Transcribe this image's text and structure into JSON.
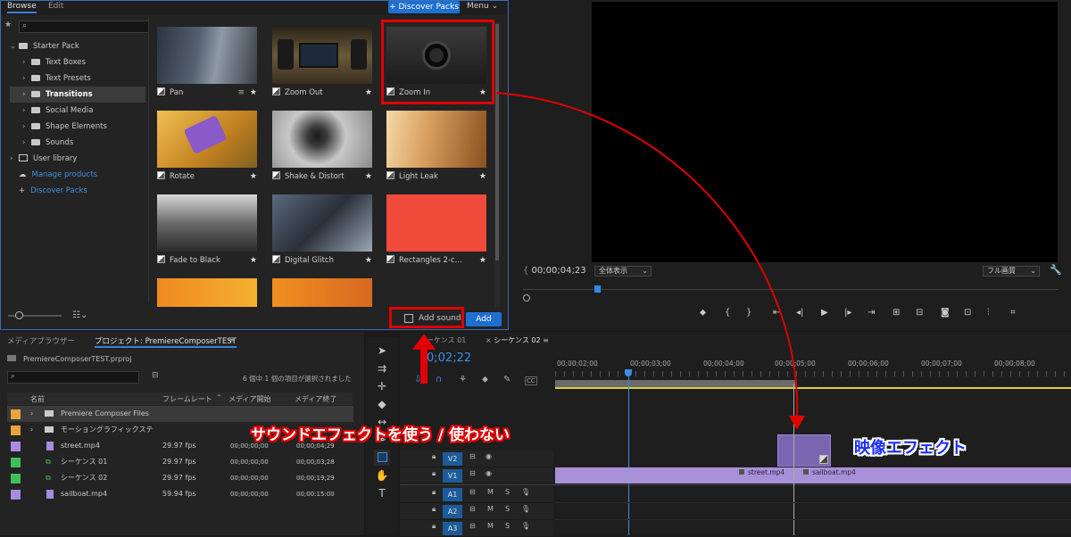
{
  "plugin": {
    "tabs": [
      "Browse",
      "Edit"
    ],
    "discover_button": "+ Discover Packs",
    "menu_label": "Menu",
    "search_placeholder": "",
    "tree": [
      {
        "label": "Starter Pack",
        "caret": "v"
      },
      {
        "label": "Text Boxes",
        "caret": ">"
      },
      {
        "label": "Text Presets",
        "caret": ">"
      },
      {
        "label": "Transitions",
        "caret": ">"
      },
      {
        "label": "Social Media",
        "caret": ">"
      },
      {
        "label": "Shape Elements",
        "caret": ">"
      },
      {
        "label": "Sounds",
        "caret": ">"
      },
      {
        "label": "User library",
        "caret": ">"
      },
      {
        "label": "Manage products"
      },
      {
        "label": "Discover Packs"
      }
    ],
    "tiles": [
      "Pan",
      "Zoom Out",
      "Zoom In",
      "Rotate",
      "Shake & Distort",
      "Light Leak",
      "Fade to Black",
      "Digital Glitch",
      "Rectangles 2-c..."
    ],
    "add_sound_label": "Add sound",
    "add_button": "Add",
    "selected_category": "Transitions",
    "selected_tile": "Zoom In"
  },
  "monitor": {
    "timecode": "00;00;04;23",
    "fit_select": "全体表示",
    "quality_select": "フル画質"
  },
  "project": {
    "tabs": [
      "メディアブラウザー",
      "プロジェクト: PremiereComposerTEST"
    ],
    "file": "PremiereComposerTEST.prproj",
    "status": "6 個中 1 個の項目が選択されました",
    "columns": [
      "名前",
      "フレームレート",
      "メディア開始",
      "メディア終了"
    ],
    "rows": [
      {
        "color": "#e8a33a",
        "name": "Premiere Composer Files",
        "fps": "",
        "start": "",
        "end": "",
        "kind": "folder"
      },
      {
        "color": "#e8a33a",
        "name": "モーショングラフィックステ",
        "fps": "",
        "start": "",
        "end": "",
        "kind": "folder"
      },
      {
        "color": "#a78be0",
        "name": "street.mp4",
        "fps": "29.97 fps",
        "start": "00;00;00;00",
        "end": "00;00;04;29",
        "kind": "file"
      },
      {
        "color": "#3fbf5a",
        "name": "シーケンス 01",
        "fps": "29.97 fps",
        "start": "00;00;00;00",
        "end": "00;00;03;28",
        "kind": "seq"
      },
      {
        "color": "#3fbf5a",
        "name": "シーケンス 02",
        "fps": "29.97 fps",
        "start": "00;00;00;00",
        "end": "00;00;19;29",
        "kind": "seq"
      },
      {
        "color": "#a78be0",
        "name": "sailboat.mp4",
        "fps": "59.94 fps",
        "start": "00;00;00;00",
        "end": "00;00:15:00",
        "kind": "file"
      }
    ]
  },
  "timeline": {
    "tabs": [
      "ーケンス 01",
      "シーケンス 02"
    ],
    "timecode": "0;02;22",
    "ruler": [
      "00;00;02;00",
      "00;00;03;00",
      "00;00;04;00",
      "00;00;05;00",
      "00;00;06;00",
      "00;00;07;00",
      "00;00;08;00"
    ],
    "tracks": [
      "V2",
      "V1",
      "A1",
      "A2",
      "A3"
    ],
    "clips": [
      "street.mp4",
      "sailboat.mp4"
    ],
    "track_buttons": [
      "M",
      "S"
    ]
  },
  "annotations": {
    "sound": "サウンドエフェクトを使う / 使わない",
    "video": "映像エフェクト"
  },
  "colors": {
    "accent_blue": "#1f6fd0",
    "annotation_red": "#e00000",
    "clip_purple": "#a78be0"
  }
}
